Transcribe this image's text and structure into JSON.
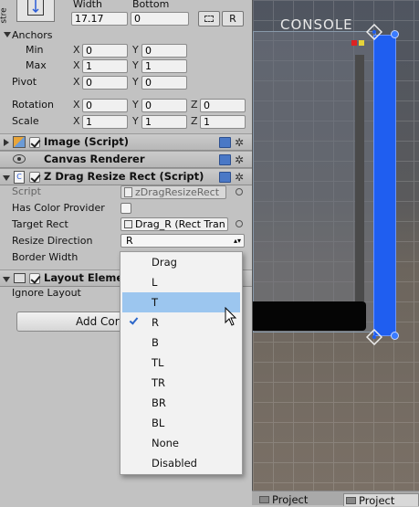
{
  "inspector": {
    "stretch_label": "stre",
    "width_label": "Width",
    "bottom_label": "Bottom",
    "width_value": "17.17",
    "bottom_value": "0",
    "r_button": "R",
    "anchors": {
      "label": "Anchors",
      "min_label": "Min",
      "max_label": "Max",
      "min_x": "0",
      "min_y": "0",
      "max_x": "1",
      "max_y": "1"
    },
    "pivot": {
      "label": "Pivot",
      "x": "0",
      "y": "0"
    },
    "rotation": {
      "label": "Rotation",
      "x": "0",
      "y": "0",
      "z": "0"
    },
    "scale": {
      "label": "Scale",
      "x": "1",
      "y": "1",
      "z": "1"
    },
    "axis": {
      "x": "X",
      "y": "Y",
      "z": "Z"
    },
    "components": {
      "image": "Image (Script)",
      "canvas_renderer": "Canvas Renderer",
      "drag_resize": "Z Drag Resize Rect (Script)",
      "layout_element": "Layout Eleme"
    },
    "script_label": "Script",
    "script_value": "zDragResizeRect",
    "has_color_label": "Has Color Provider",
    "target_rect_label": "Target Rect",
    "target_rect_value": "Drag_R (Rect Tran",
    "resize_dir_label": "Resize Direction",
    "resize_dir_value": "R",
    "border_width_label": "Border Width",
    "ignore_layout_label": "Ignore Layout",
    "add_component": "Add Cor"
  },
  "dropdown": {
    "options": [
      "Drag",
      "L",
      "T",
      "R",
      "B",
      "TL",
      "TR",
      "BR",
      "BL",
      "None",
      "Disabled"
    ],
    "selected": "R",
    "highlighted": "T"
  },
  "scene": {
    "console_label": "CONSOLE"
  },
  "tabs": [
    "Project",
    "Project"
  ],
  "colors": {
    "accent_blue": "#1f5ef0",
    "highlight": "#9cc6ef",
    "panel_bg": "#c2c2c2"
  }
}
